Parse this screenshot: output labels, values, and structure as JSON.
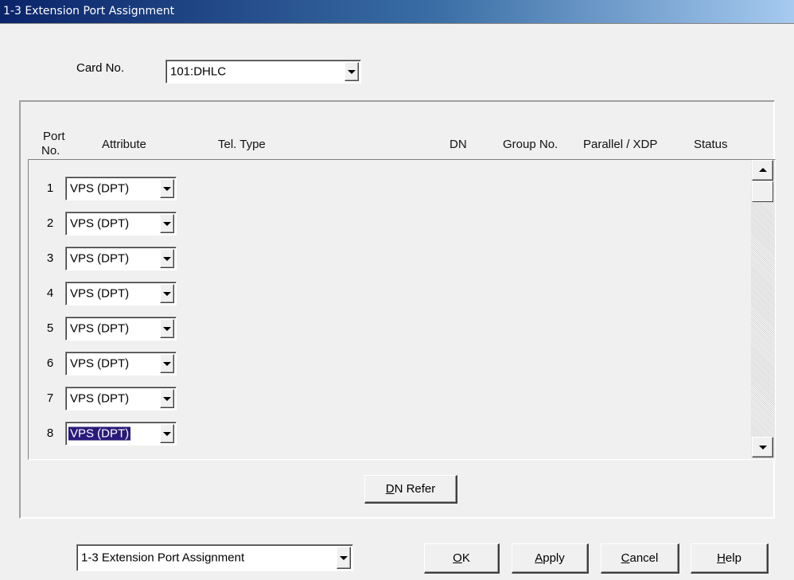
{
  "window": {
    "title": "1-3 Extension Port Assignment"
  },
  "card": {
    "label": "Card No.",
    "value": "101:DHLC"
  },
  "columns": {
    "port_line1": "Port",
    "port_line2": "No.",
    "attribute": "Attribute",
    "tel_type": "Tel. Type",
    "dn": "DN",
    "group_no": "Group No.",
    "parallel_xdp": "Parallel / XDP",
    "status": "Status"
  },
  "rows": [
    {
      "port": "1",
      "attribute": "VPS (DPT)",
      "selected": false
    },
    {
      "port": "2",
      "attribute": "VPS (DPT)",
      "selected": false
    },
    {
      "port": "3",
      "attribute": "VPS (DPT)",
      "selected": false
    },
    {
      "port": "4",
      "attribute": "VPS (DPT)",
      "selected": false
    },
    {
      "port": "5",
      "attribute": "VPS (DPT)",
      "selected": false
    },
    {
      "port": "6",
      "attribute": "VPS (DPT)",
      "selected": false
    },
    {
      "port": "7",
      "attribute": "VPS (DPT)",
      "selected": false
    },
    {
      "port": "8",
      "attribute": "VPS (DPT)",
      "selected": true
    }
  ],
  "buttons": {
    "dn_refer_mnemonic": "D",
    "dn_refer_rest": "N Refer",
    "ok_mnemonic": "O",
    "ok_rest": "K",
    "apply_mnemonic": "A",
    "apply_rest": "pply",
    "cancel_mnemonic": "C",
    "cancel_rest": "ancel",
    "help_mnemonic": "H",
    "help_rest": "elp"
  },
  "page_select": {
    "value": "1-3 Extension Port Assignment"
  },
  "colors": {
    "title_gradient_start": "#0a246a",
    "title_gradient_end": "#a6caf0",
    "face": "#f0f0f0",
    "selection": "#2a1a7a"
  },
  "icons": [
    "dropdown-arrow-icon",
    "scroll-up-icon",
    "scroll-down-icon"
  ]
}
